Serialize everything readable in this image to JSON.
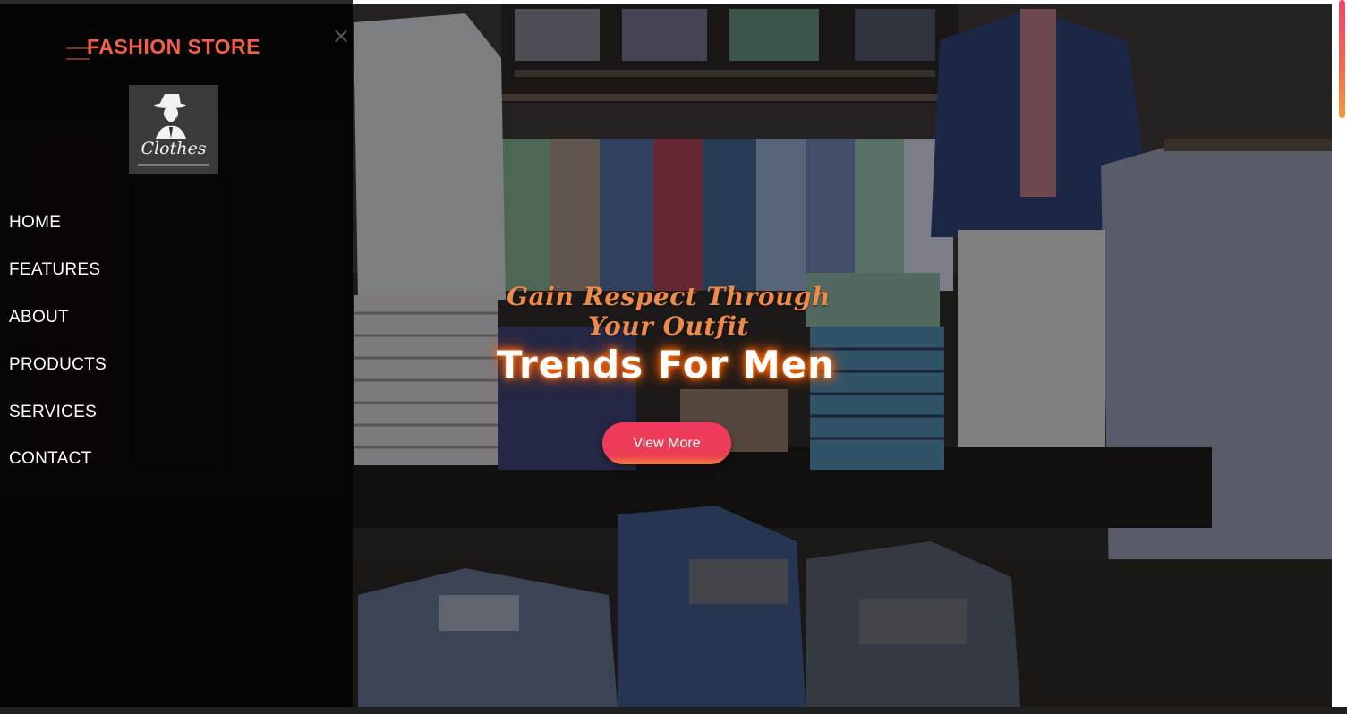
{
  "sidebar": {
    "brand": "FASHION STORE",
    "logo_text": "Clothes",
    "close_icon": "close-icon",
    "nav": [
      {
        "label": "HOME"
      },
      {
        "label": "FEATURES"
      },
      {
        "label": "ABOUT"
      },
      {
        "label": "PRODUCTS"
      },
      {
        "label": "SERVICES"
      },
      {
        "label": "CONTACT"
      }
    ]
  },
  "hero": {
    "tagline": "Gain Respect Through Your Outfit",
    "headline": "Trends For Men",
    "cta_label": "View More",
    "background": "clothing-store-photo"
  },
  "colors": {
    "brand": "#f0604a",
    "tagline": "#f08a4b",
    "cta": "#ec3f56",
    "scroll_thumb": "#f1436a"
  }
}
